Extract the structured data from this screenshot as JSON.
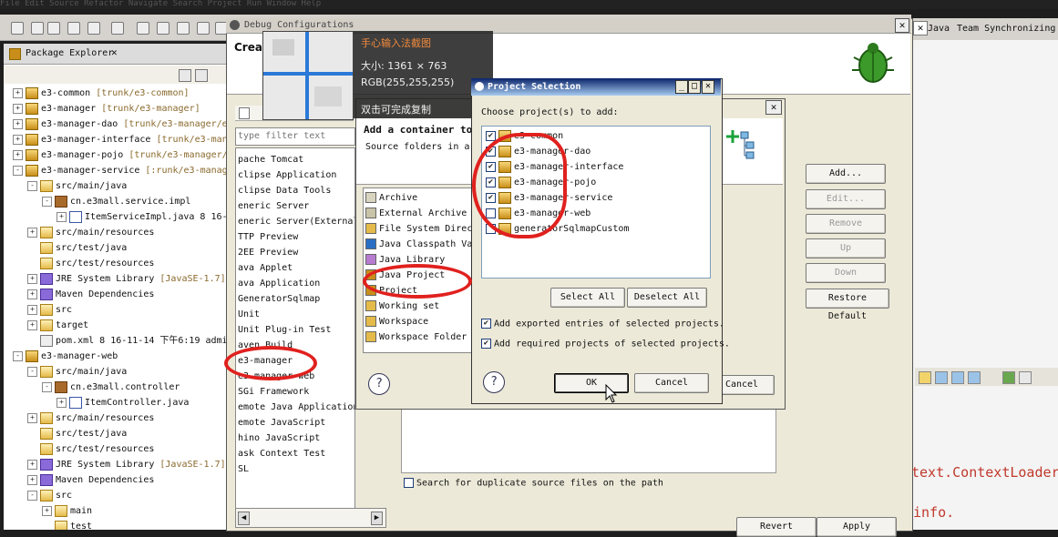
{
  "menubar": "File  Edit  Source  Refactor  Navigate  Search  Project  Run  Window  Help",
  "perspectives": {
    "java": "Java",
    "team": "Team Synchronizing"
  },
  "package_explorer": {
    "title": "Package Explorer",
    "rows": [
      {
        "indent": 0,
        "twist": "+",
        "icon": "ic-proj",
        "text": "e3-common",
        "dim": " [trunk/e3-common]"
      },
      {
        "indent": 0,
        "twist": "+",
        "icon": "ic-proj",
        "text": "e3-manager",
        "dim": " [trunk/e3-manager]"
      },
      {
        "indent": 0,
        "twist": "+",
        "icon": "ic-proj",
        "text": "e3-manager-dao",
        "dim": " [trunk/e3-manager/e3-m"
      },
      {
        "indent": 0,
        "twist": "+",
        "icon": "ic-proj",
        "text": "e3-manager-interface",
        "dim": " [trunk/e3-manage"
      },
      {
        "indent": 0,
        "twist": "+",
        "icon": "ic-proj",
        "text": "e3-manager-pojo",
        "dim": " [trunk/e3-manager/e3"
      },
      {
        "indent": 0,
        "twist": "-",
        "icon": "ic-proj",
        "text": "e3-manager-service",
        "dim": " [:runk/e3-manager/"
      },
      {
        "indent": 1,
        "twist": "-",
        "icon": "ic-folder",
        "text": "src/main/java",
        "dim": ""
      },
      {
        "indent": 2,
        "twist": "-",
        "icon": "ic-pkg",
        "text": "cn.e3mall.service.impl",
        "dim": ""
      },
      {
        "indent": 3,
        "twist": "+",
        "icon": "ic-java",
        "text": "ItemServiceImpl.java 8  16-1",
        "dim": ""
      },
      {
        "indent": 1,
        "twist": "+",
        "icon": "ic-folder",
        "text": "src/main/resources",
        "dim": ""
      },
      {
        "indent": 1,
        "twist": "",
        "icon": "ic-folder",
        "text": "src/test/java",
        "dim": ""
      },
      {
        "indent": 1,
        "twist": "",
        "icon": "ic-folder",
        "text": "src/test/resources",
        "dim": ""
      },
      {
        "indent": 1,
        "twist": "+",
        "icon": "ic-lib",
        "text": "JRE System Library",
        "dim": " [JavaSE-1.7]"
      },
      {
        "indent": 1,
        "twist": "+",
        "icon": "ic-lib",
        "text": "Maven Dependencies",
        "dim": ""
      },
      {
        "indent": 1,
        "twist": "+",
        "icon": "ic-folder",
        "text": "src",
        "dim": ""
      },
      {
        "indent": 1,
        "twist": "+",
        "icon": "ic-folder",
        "text": "target",
        "dim": ""
      },
      {
        "indent": 1,
        "twist": "",
        "icon": "ic-xml",
        "text": "pom.xml 8  16-11-14 下午6:19  admi",
        "dim": ""
      },
      {
        "indent": 0,
        "twist": "-",
        "icon": "ic-proj",
        "text": "e3-manager-web",
        "dim": ""
      },
      {
        "indent": 1,
        "twist": "-",
        "icon": "ic-folder",
        "text": "src/main/java",
        "dim": ""
      },
      {
        "indent": 2,
        "twist": "-",
        "icon": "ic-pkg",
        "text": "cn.e3mall.controller",
        "dim": ""
      },
      {
        "indent": 3,
        "twist": "+",
        "icon": "ic-java",
        "text": "ItemController.java",
        "dim": ""
      },
      {
        "indent": 1,
        "twist": "+",
        "icon": "ic-folder",
        "text": "src/main/resources",
        "dim": ""
      },
      {
        "indent": 1,
        "twist": "",
        "icon": "ic-folder",
        "text": "src/test/java",
        "dim": ""
      },
      {
        "indent": 1,
        "twist": "",
        "icon": "ic-folder",
        "text": "src/test/resources",
        "dim": ""
      },
      {
        "indent": 1,
        "twist": "+",
        "icon": "ic-lib",
        "text": "JRE System Library",
        "dim": " [JavaSE-1.7]"
      },
      {
        "indent": 1,
        "twist": "+",
        "icon": "ic-lib",
        "text": "Maven Dependencies",
        "dim": ""
      },
      {
        "indent": 1,
        "twist": "-",
        "icon": "ic-folder",
        "text": "src",
        "dim": ""
      },
      {
        "indent": 2,
        "twist": "+",
        "icon": "ic-folder",
        "text": "main",
        "dim": ""
      },
      {
        "indent": 2,
        "twist": "",
        "icon": "ic-folder",
        "text": "test",
        "dim": ""
      }
    ]
  },
  "debug_dialog": {
    "title": "Debug Configurations",
    "banner_title": "Creat",
    "filter_placeholder": "type filter text",
    "configs": [
      "pache Tomcat",
      "clipse Application",
      "clipse Data Tools",
      "eneric Server",
      "eneric Server(External L",
      "TTP Preview",
      "2EE Preview",
      "ava Applet",
      "ava Application",
      " GeneratorSqlmap",
      "Unit",
      "Unit Plug-in Test",
      "aven Build",
      "e3-manager",
      "e3-manager-web",
      "SGi Framework",
      "emote Java Application",
      "emote JavaScript",
      "hino JavaScript",
      "ask Context Test",
      "SL"
    ],
    "buttons": {
      "add": "Add...",
      "edit": "Edit...",
      "remove": "Remove",
      "up": "Up",
      "down": "Down",
      "restore": "Restore Default",
      "revert": "Revert",
      "apply": "Apply"
    },
    "search_dup": "Search for duplicate source files on the path",
    "console_line1": "text.ContextLoader",
    "console_line2": "info."
  },
  "add_container": {
    "title": "Add a container to th",
    "desc": "Source folders in a J",
    "items": [
      "Archive",
      "External Archive",
      "File System Direct",
      "Java Classpath Var",
      "Java Library",
      "Java Project",
      "Project",
      "Working set",
      "Workspace",
      "Workspace Folder"
    ],
    "cancel": "Cancel"
  },
  "project_selection": {
    "title": "Project Selection",
    "prompt": "Choose project(s) to add:",
    "projects": [
      {
        "name": "e3-common",
        "checked": true
      },
      {
        "name": "e3-manager-dao",
        "checked": true
      },
      {
        "name": "e3-manager-interface",
        "checked": true
      },
      {
        "name": "e3-manager-pojo",
        "checked": true
      },
      {
        "name": "e3-manager-service",
        "checked": true
      },
      {
        "name": "e3-manager-web",
        "checked": false
      },
      {
        "name": "generatorSqlmapCustom",
        "checked": false
      }
    ],
    "select_all": "Select All",
    "deselect_all": "Deselect All",
    "add_exported": "Add exported entries of selected projects.",
    "add_required": "Add required projects of selected projects.",
    "ok": "OK",
    "cancel": "Cancel"
  },
  "tooltip": {
    "title": "手心输入法截图",
    "size": "大小: 1361 × 763",
    "rgb": "RGB(255,255,255)",
    "hint": "双击可完成复制"
  }
}
